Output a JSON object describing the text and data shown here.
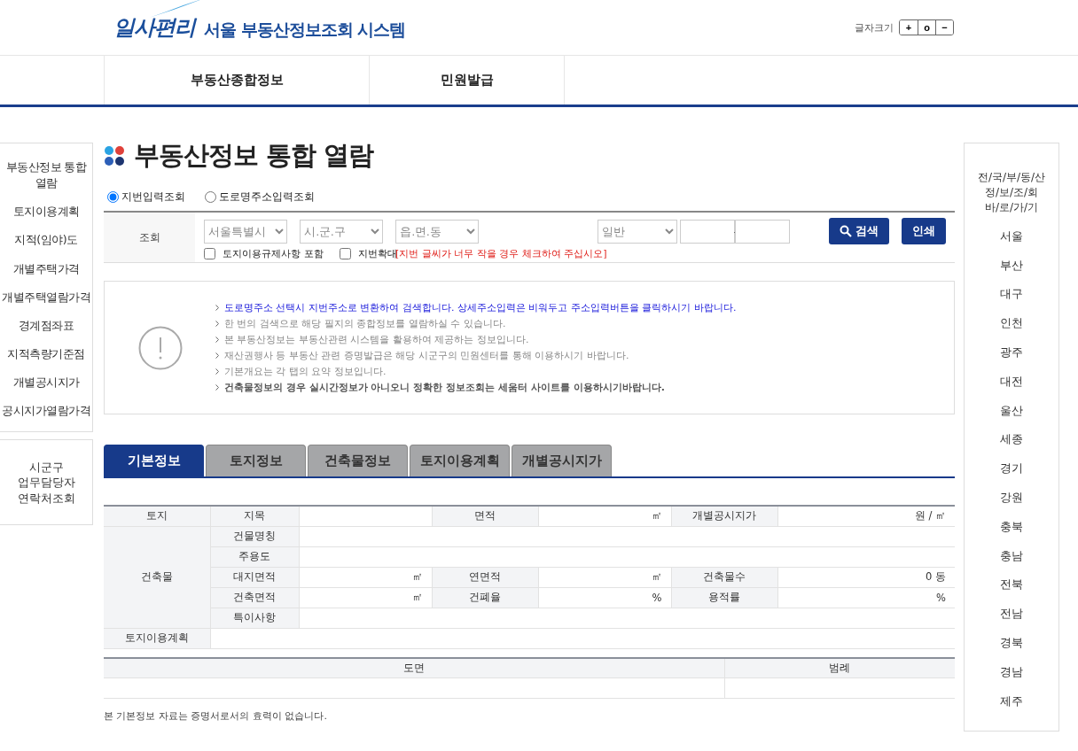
{
  "header": {
    "logo": "일사편리",
    "title": "서울 부동산정보조회 시스템",
    "font_size": {
      "label": "글자크기",
      "buttons": [
        "+",
        "o",
        "−"
      ]
    }
  },
  "nav": {
    "items": [
      {
        "label": "부동산종합정보",
        "selected": false
      },
      {
        "label": "민원발급",
        "selected": false
      }
    ]
  },
  "left_sidebar": {
    "items": [
      "부동산정보 통합 열람",
      "토지이용계획",
      "지적(임야)도",
      "개별주택가격",
      "개별주택열람가격",
      "경계점좌표",
      "지적측량기준점",
      "개별공시지가",
      "공시지가열람가격"
    ],
    "contact": "시군구 업무담당자 연락처조회"
  },
  "page_title": "부동산정보 통합 열람",
  "search_mode": [
    {
      "label": "지번입력조회",
      "selected": true
    },
    {
      "label": "도로명주소입력조회",
      "selected": false
    }
  ],
  "search": {
    "label": "조회",
    "selects": [
      "서울특별시",
      "시.군.구",
      "읍.면.동",
      "일반"
    ],
    "separator": "-",
    "checkboxes": [
      {
        "label": "토지이용규제사항 포함",
        "checked": false
      },
      {
        "label": "지번확대",
        "checked": false,
        "note": "[지번 글씨가 너무 작을 경우 체크하여 주십시오]"
      }
    ],
    "buttons": [
      {
        "kind": "search",
        "label": "검색"
      },
      {
        "kind": "print",
        "label": "인쇄"
      }
    ]
  },
  "notice": [
    {
      "kind": "link",
      "text": "도로명주소 선택시 지번주소로 변환하여 검색합니다. 상세주소입력은 비워두고 주소입력버튼을 클릭하시기 바랍니다."
    },
    {
      "kind": "normal",
      "text": "한 번의 검색으로 해당 필지의 종합정보를 열람하실 수 있습니다."
    },
    {
      "kind": "normal",
      "text": "본 부동산정보는 부동산관련 시스템을 활용하여 제공하는 정보입니다."
    },
    {
      "kind": "normal",
      "text": "재산권행사 등 부동산 관련 증명발급은 해당 시군구의 민원센터를 통해 이용하시기 바랍니다."
    },
    {
      "kind": "normal",
      "text": "기본개요는 각 탭의 요약 정보입니다."
    },
    {
      "kind": "bold",
      "text": "건축물정보의 경우 실시간정보가 아니오니 정확한 정보조회는 세움터 사이트를 이용하시기바랍니다."
    }
  ],
  "tabs": [
    {
      "label": "기본정보",
      "selected": true
    },
    {
      "label": "토지정보",
      "selected": false
    },
    {
      "label": "건축물정보",
      "selected": false
    },
    {
      "label": "토지이용계획",
      "selected": false
    },
    {
      "label": "개별공시지가",
      "selected": false
    }
  ],
  "info_table": {
    "land": {
      "label": "토지",
      "items": [
        {
          "label": "지목"
        },
        {
          "label": "면적",
          "unit": "㎡"
        },
        {
          "label": "개별공시지가",
          "unit": "원 / ㎡"
        }
      ]
    },
    "building": {
      "label": "건축물",
      "rows": [
        [
          {
            "label": "건물명칭"
          }
        ],
        [
          {
            "label": "주용도"
          }
        ],
        [
          {
            "label": "대지면적",
            "unit": "㎡"
          },
          {
            "label": "연면적",
            "unit": "㎡"
          },
          {
            "label": "건축물수",
            "unit": "0 동"
          }
        ],
        [
          {
            "label": "건축면적",
            "unit": "㎡"
          },
          {
            "label": "건폐율",
            "unit": "%"
          },
          {
            "label": "용적률",
            "unit": "%"
          }
        ],
        [
          {
            "label": "특이사항"
          }
        ]
      ]
    },
    "plan": {
      "label": "토지이용계획"
    }
  },
  "map_table": {
    "columns": [
      "도면",
      "범례"
    ]
  },
  "footnote": "본 기본정보 자료는 증명서로서의 효력이 없습니다.",
  "right_sidebar": {
    "title": [
      "전/국/부/동/산",
      "정/보/조/회",
      "바/로/가/기"
    ],
    "regions": [
      "서울",
      "부산",
      "대구",
      "인천",
      "광주",
      "대전",
      "울산",
      "세종",
      "경기",
      "강원",
      "충북",
      "충남",
      "전북",
      "전남",
      "경북",
      "경남",
      "제주"
    ]
  }
}
